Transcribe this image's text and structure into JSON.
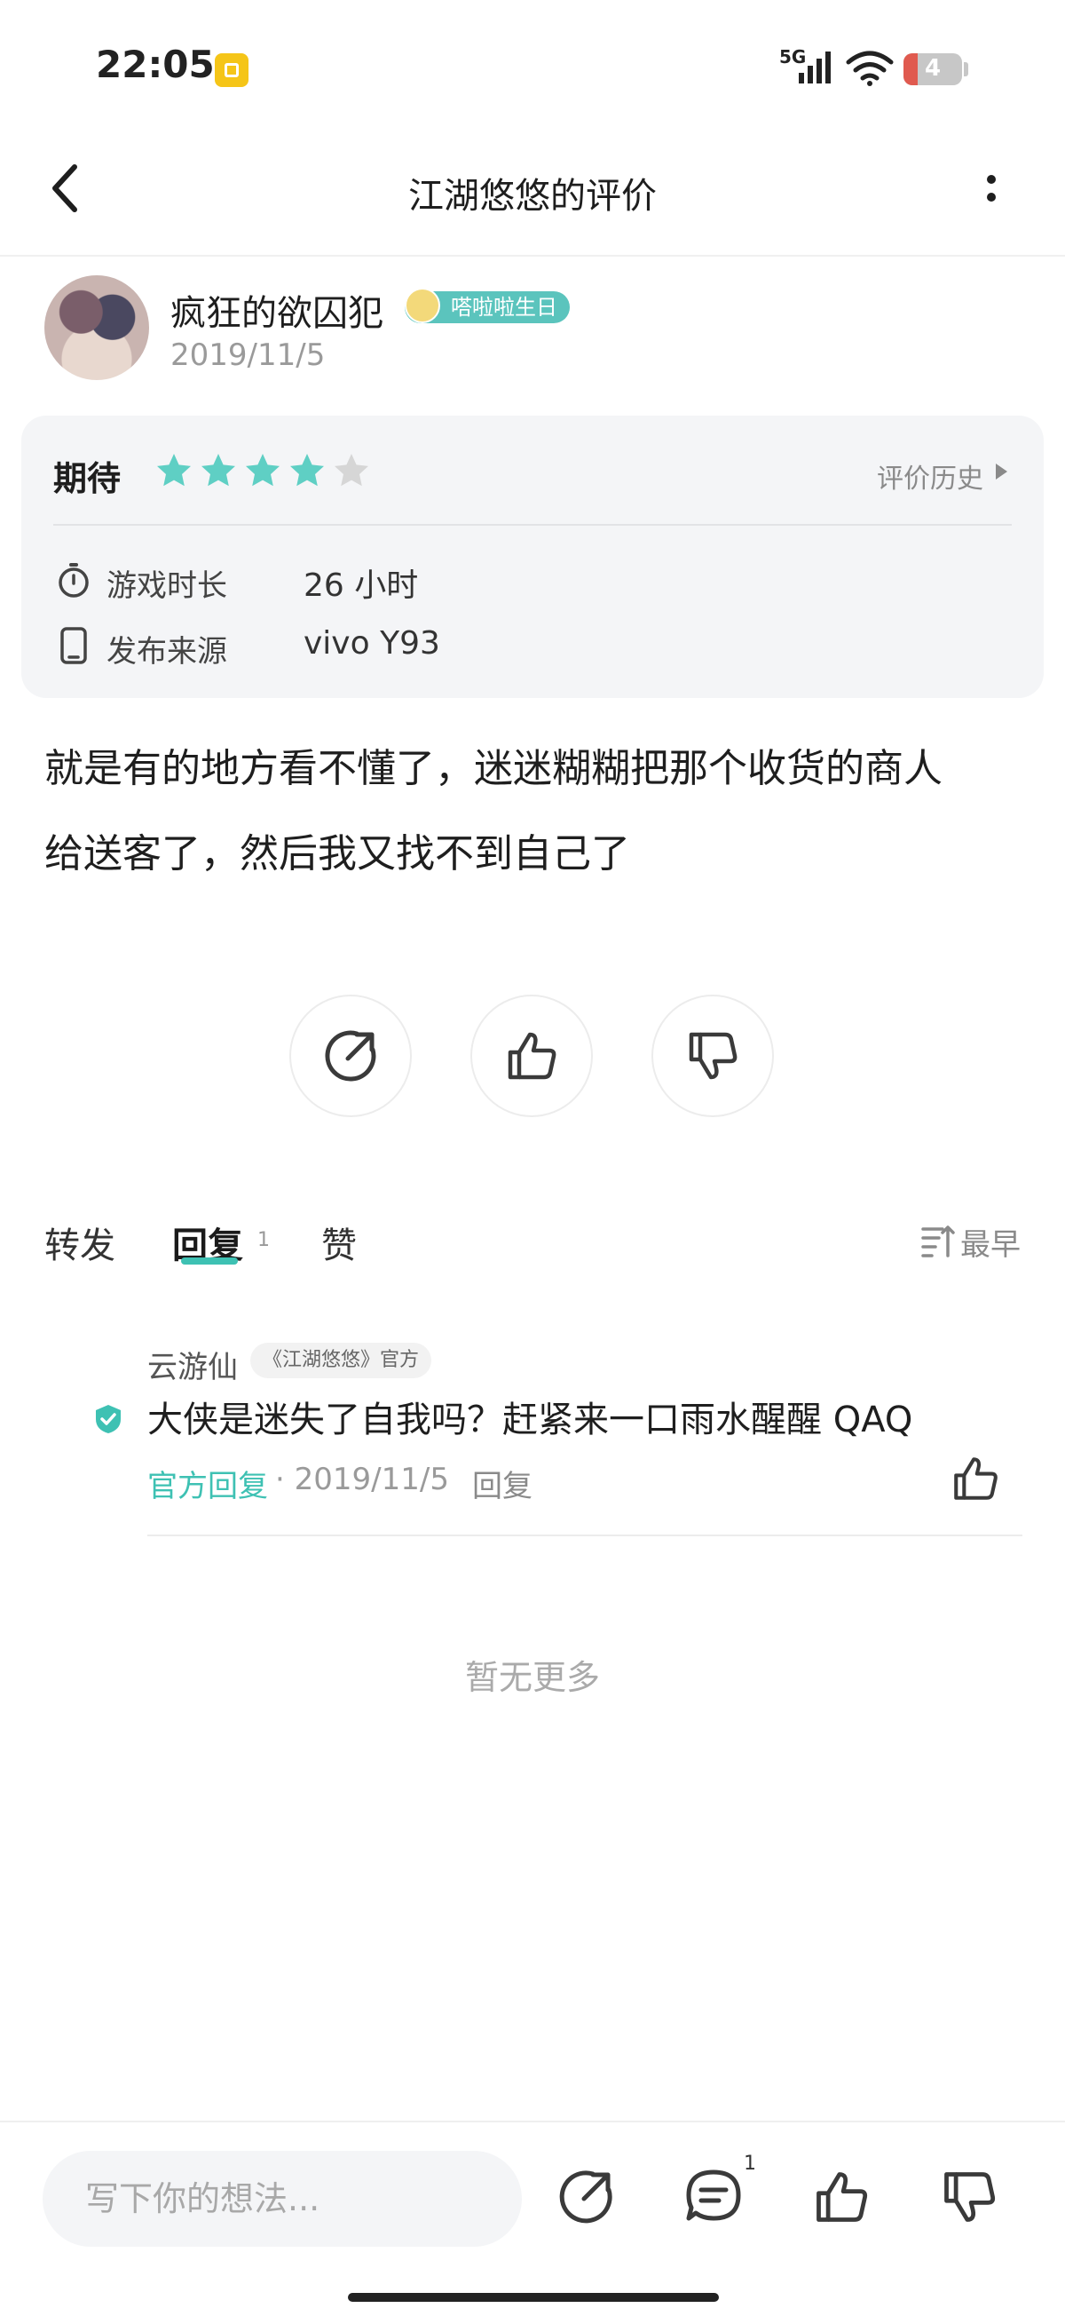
{
  "status_bar": {
    "time": "22:05",
    "network": "5G",
    "battery_level": "4",
    "icons": [
      "app-notification-icon",
      "signal-icon",
      "wifi-icon",
      "battery-icon"
    ]
  },
  "nav": {
    "title": "江湖悠悠的评价"
  },
  "review": {
    "username": "疯狂的欲囚犯",
    "badge": "嗒啦啦生日",
    "date": "2019/11/5",
    "rating_label": "期待",
    "rating": 4,
    "rating_max": 5,
    "history_link": "评价历史",
    "info": [
      {
        "icon": "timer-icon",
        "label": "游戏时长",
        "value": "26 小时"
      },
      {
        "icon": "phone-icon",
        "label": "发布来源",
        "value": "vivo Y93"
      }
    ],
    "content_line1": "就是有的地方看不懂了，迷迷糊糊把那个收货的商人",
    "content_line2": "给送客了，然后我又找不到自己了"
  },
  "tabs": {
    "repost": "转发",
    "reply": "回复",
    "reply_count": "1",
    "like": "赞",
    "sort": "最早"
  },
  "replies": [
    {
      "name": "云游仙",
      "tag": "《江湖悠悠》官方",
      "text": "大侠是迷失了自我吗？赶紧来一口雨水醒醒 QAQ",
      "official_label": "官方回复",
      "date": "· 2019/11/5",
      "reply_action": "回复"
    }
  ],
  "no_more": "暂无更多",
  "bottom_bar": {
    "input_placeholder": "写下你的想法...",
    "comment_count": "1"
  },
  "colors": {
    "accent": "#3ec1b3",
    "star_filled": "#5fcfc4",
    "star_empty": "#d6d6d6",
    "card_bg": "#f4f5f7"
  }
}
